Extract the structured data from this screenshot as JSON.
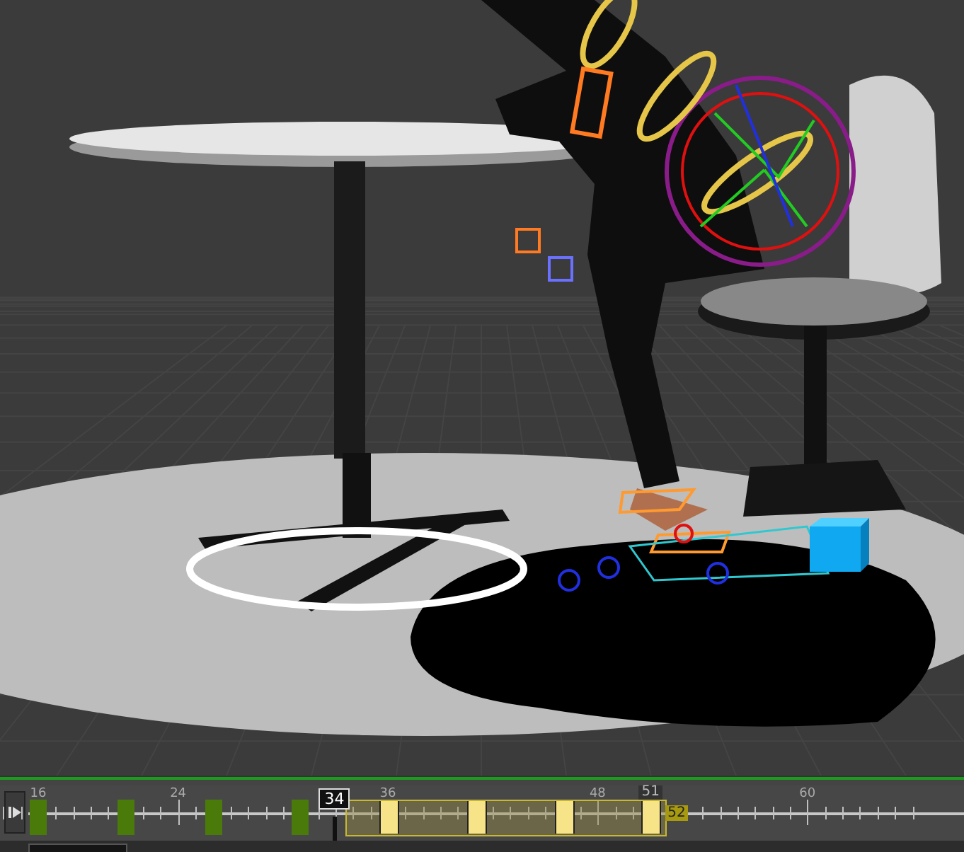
{
  "timeline": {
    "ruler_labels": [
      "16",
      "24",
      "36",
      "48",
      "60"
    ],
    "keys": [
      {
        "selected": false
      },
      {
        "selected": false
      },
      {
        "selected": false
      },
      {
        "selected": false
      },
      {
        "selected": true
      },
      {
        "selected": true
      },
      {
        "selected": true
      },
      {
        "selected": true
      }
    ],
    "current_frame": "34",
    "selection_end_frame": "51",
    "range_end": "52"
  }
}
